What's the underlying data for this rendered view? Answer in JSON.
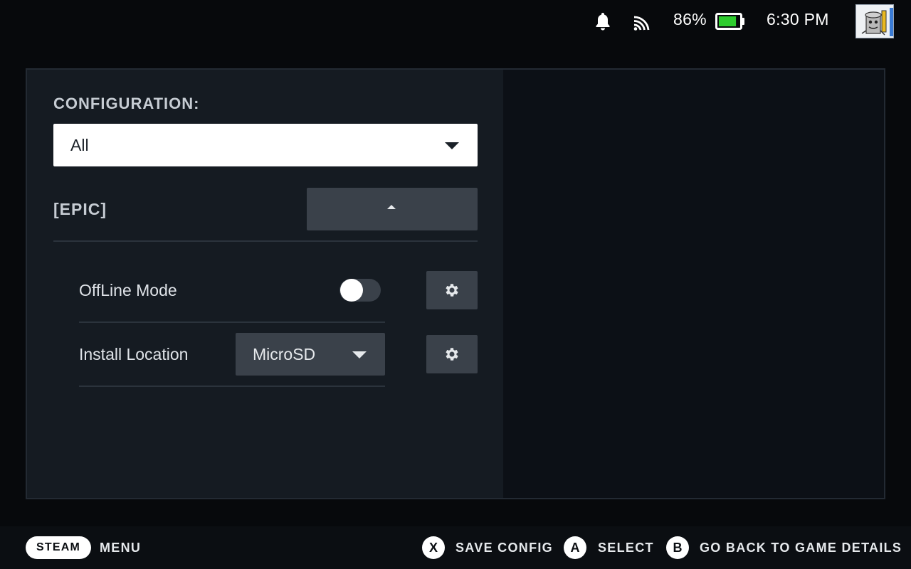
{
  "status": {
    "battery_percent": "86%",
    "battery_level": 0.86,
    "time": "6:30 PM",
    "icons": [
      "bell-icon",
      "cast-signal-icon",
      "battery-icon",
      "avatar"
    ]
  },
  "config": {
    "label": "CONFIGURATION:",
    "selected": "All"
  },
  "section": {
    "title": "[EPIC]"
  },
  "rows": {
    "offline_mode": {
      "label": "OffLine Mode",
      "enabled": false
    },
    "install_location": {
      "label": "Install Location",
      "value": "MicroSD"
    }
  },
  "footer": {
    "steam": "STEAM",
    "menu": "MENU",
    "x_key": "X",
    "save_config": "SAVE CONFIG",
    "a_key": "A",
    "select": "SELECT",
    "b_key": "B",
    "back": "GO BACK TO GAME DETAILS"
  },
  "colors": {
    "background": "#07090c",
    "panel": "#151b22",
    "control": "#3a414a",
    "battery_fill": "#2ecc2e"
  }
}
